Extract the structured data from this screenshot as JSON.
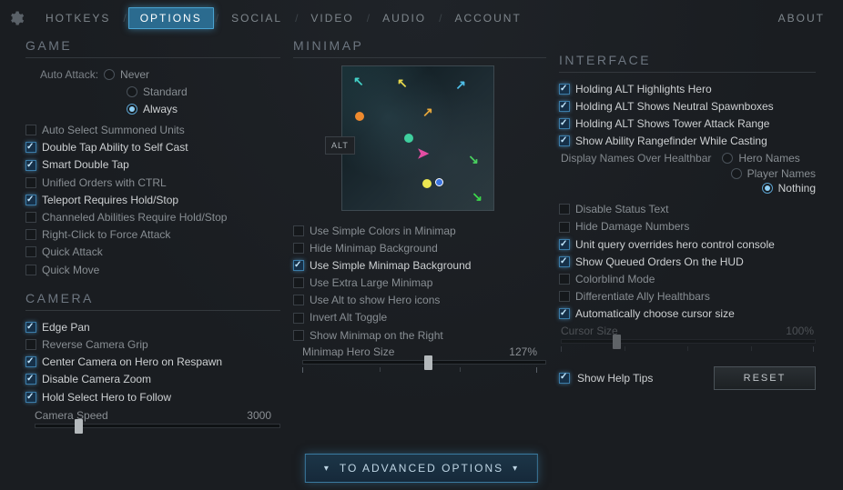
{
  "topbar": {
    "tabs": [
      "HOTKEYS",
      "OPTIONS",
      "SOCIAL",
      "VIDEO",
      "AUDIO",
      "ACCOUNT"
    ],
    "active": 1,
    "about": "ABOUT"
  },
  "game": {
    "title": "GAME",
    "auto_attack_label": "Auto Attack:",
    "auto_attack": {
      "options": [
        "Never",
        "Standard",
        "Always"
      ],
      "selected": 2
    },
    "opts": [
      {
        "label": "Auto Select Summoned Units",
        "on": false
      },
      {
        "label": "Double Tap Ability to Self Cast",
        "on": true
      },
      {
        "label": "Smart Double Tap",
        "on": true
      },
      {
        "label": "Unified Orders with CTRL",
        "on": false
      },
      {
        "label": "Teleport Requires Hold/Stop",
        "on": true
      },
      {
        "label": "Channeled Abilities Require Hold/Stop",
        "on": false
      },
      {
        "label": "Right-Click to Force Attack",
        "on": false
      },
      {
        "label": "Quick Attack",
        "on": false
      },
      {
        "label": "Quick Move",
        "on": false
      }
    ]
  },
  "camera": {
    "title": "CAMERA",
    "opts": [
      {
        "label": "Edge Pan",
        "on": true
      },
      {
        "label": "Reverse Camera Grip",
        "on": false
      },
      {
        "label": "Center Camera on Hero on Respawn",
        "on": true
      },
      {
        "label": "Disable Camera Zoom",
        "on": true
      },
      {
        "label": "Hold Select Hero to Follow",
        "on": true
      }
    ],
    "speed_label": "Camera Speed",
    "speed_value": "3000",
    "speed_pct": 16
  },
  "minimap": {
    "title": "MINIMAP",
    "alt": "ALT",
    "opts": [
      {
        "label": "Use Simple Colors in Minimap",
        "on": false
      },
      {
        "label": "Hide Minimap Background",
        "on": false
      },
      {
        "label": "Use Simple Minimap Background",
        "on": true
      },
      {
        "label": "Use Extra Large Minimap",
        "on": false
      },
      {
        "label": "Use Alt to show Hero icons",
        "on": false
      },
      {
        "label": "Invert Alt Toggle",
        "on": false
      },
      {
        "label": "Show Minimap on the Right",
        "on": false
      }
    ],
    "hero_size_label": "Minimap Hero Size",
    "hero_size_value": "127%",
    "hero_size_pct": 50
  },
  "interface": {
    "title": "INTERFACE",
    "top_opts": [
      {
        "label": "Holding ALT Highlights Hero",
        "on": true
      },
      {
        "label": "Holding ALT Shows Neutral Spawnboxes",
        "on": true
      },
      {
        "label": "Holding ALT Shows Tower Attack Range",
        "on": true
      },
      {
        "label": "Show Ability Rangefinder While Casting",
        "on": true
      }
    ],
    "names_label": "Display Names Over Healthbar",
    "names": {
      "options": [
        "Hero Names",
        "Player Names",
        "Nothing"
      ],
      "selected": 2
    },
    "mid_opts": [
      {
        "label": "Disable Status Text",
        "on": false
      },
      {
        "label": "Hide Damage Numbers",
        "on": false
      },
      {
        "label": "Unit query overrides hero control console",
        "on": true
      },
      {
        "label": "Show Queued Orders On the HUD",
        "on": true
      },
      {
        "label": "Colorblind Mode",
        "on": false
      },
      {
        "label": "Differentiate Ally Healthbars",
        "on": false
      },
      {
        "label": "Automatically choose cursor size",
        "on": true
      }
    ],
    "cursor_label": "Cursor Size",
    "cursor_value": "100%",
    "cursor_pct": 20,
    "help_label": "Show Help Tips",
    "help_on": true,
    "reset": "RESET"
  },
  "advanced": "TO ADVANCED OPTIONS"
}
